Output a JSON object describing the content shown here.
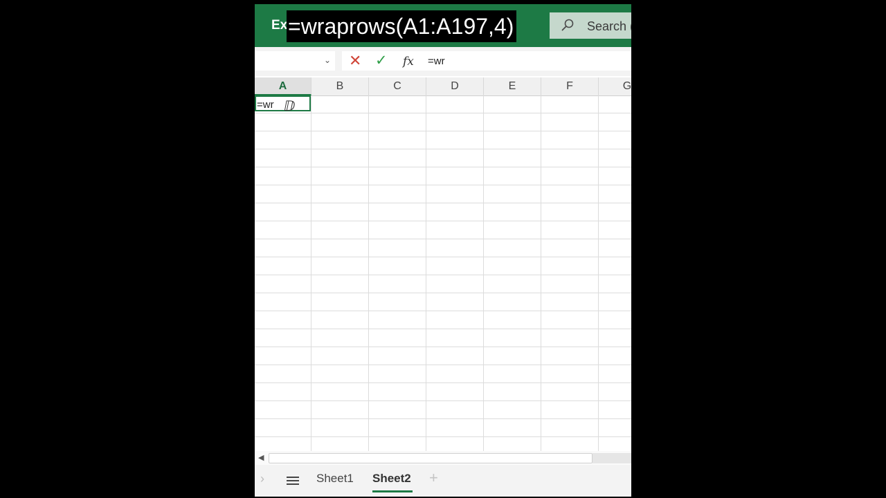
{
  "titlebar": {
    "app_name": "Ex",
    "caption": "=wraprows(A1:A197,4)",
    "search_label": "Search (",
    "accent": "#1d7a45"
  },
  "formula_bar": {
    "name_box": "",
    "cancel_icon": "close-icon",
    "enter_icon": "check-icon",
    "fx_label": "fx",
    "formula": "=wr"
  },
  "grid": {
    "columns": [
      "A",
      "B",
      "C",
      "D",
      "E",
      "F",
      "G"
    ],
    "active_column": "A",
    "active_cell_value": "=wr"
  },
  "sheets": {
    "tabs": [
      "Sheet1",
      "Sheet2"
    ],
    "active": "Sheet2",
    "add_label": "+"
  }
}
